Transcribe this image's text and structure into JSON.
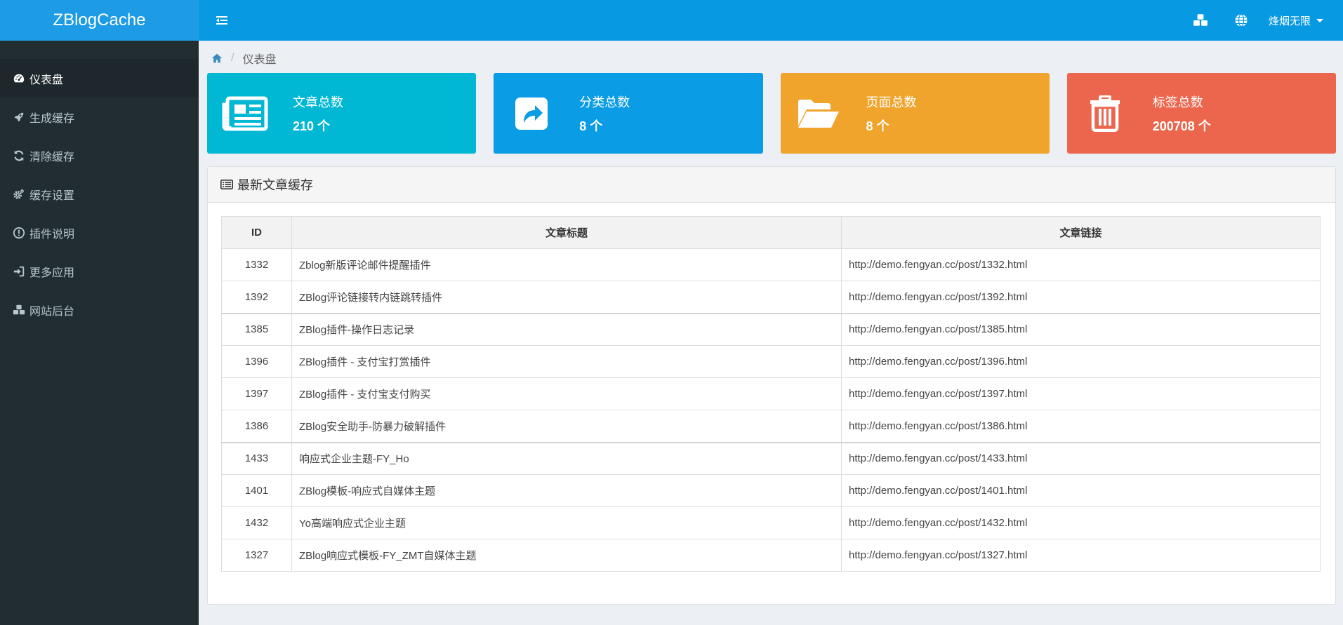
{
  "app": {
    "title": "ZBlogCache"
  },
  "sidebar": {
    "items": [
      {
        "label": "仪表盘",
        "icon": "dashboard-icon",
        "active": true
      },
      {
        "label": "生成缓存",
        "icon": "rocket-icon"
      },
      {
        "label": "清除缓存",
        "icon": "refresh-icon"
      },
      {
        "label": "缓存设置",
        "icon": "gears-icon"
      },
      {
        "label": "插件说明",
        "icon": "exclamation-circle-icon"
      },
      {
        "label": "更多应用",
        "icon": "sign-in-icon"
      },
      {
        "label": "网站后台",
        "icon": "cubes-icon"
      }
    ]
  },
  "topbar": {
    "toggle_icon": "sidebar-toggle-icon",
    "icons": [
      "cubes-icon",
      "globe-icon"
    ],
    "user_name": "烽烟无限"
  },
  "breadcrumb": {
    "icon": "home-icon",
    "current": "仪表盘",
    "separator": "/"
  },
  "stats": [
    {
      "label": "文章总数",
      "value": "210 个",
      "color": "#00b7d4",
      "icon": "newspaper-icon"
    },
    {
      "label": "分类总数",
      "value": "8 个",
      "color": "#0a9ce5",
      "icon": "share-square-icon"
    },
    {
      "label": "页面总数",
      "value": "8 个",
      "color": "#f1a42b",
      "icon": "folder-open-icon"
    },
    {
      "label": "标签总数",
      "value": "200708 个",
      "color": "#ec664d",
      "icon": "trash-icon"
    }
  ],
  "panel": {
    "title": "最新文章缓存",
    "columns": [
      "ID",
      "文章标题",
      "文章链接"
    ],
    "rows": [
      {
        "id": "1332",
        "title": "Zblog新版评论邮件提醒插件",
        "link": "http://demo.fengyan.cc/post/1332.html"
      },
      {
        "id": "1392",
        "title": "ZBlog评论链接转内链跳转插件",
        "link": "http://demo.fengyan.cc/post/1392.html"
      },
      {
        "id": "1385",
        "title": "ZBlog插件-操作日志记录",
        "link": "http://demo.fengyan.cc/post/1385.html"
      },
      {
        "id": "1396",
        "title": "ZBlog插件 - 支付宝打赏插件",
        "link": "http://demo.fengyan.cc/post/1396.html"
      },
      {
        "id": "1397",
        "title": "ZBlog插件 - 支付宝支付购买",
        "link": "http://demo.fengyan.cc/post/1397.html"
      },
      {
        "id": "1386",
        "title": "ZBlog安全助手-防暴力破解插件",
        "link": "http://demo.fengyan.cc/post/1386.html"
      },
      {
        "id": "1433",
        "title": "响应式企业主题-FY_Ho",
        "link": "http://demo.fengyan.cc/post/1433.html"
      },
      {
        "id": "1401",
        "title": "ZBlog模板-响应式自媒体主题",
        "link": "http://demo.fengyan.cc/post/1401.html"
      },
      {
        "id": "1432",
        "title": "Yo高端响应式企业主题",
        "link": "http://demo.fengyan.cc/post/1432.html"
      },
      {
        "id": "1327",
        "title": "ZBlog响应式模板-FY_ZMT自媒体主题",
        "link": "http://demo.fengyan.cc/post/1327.html"
      }
    ]
  }
}
